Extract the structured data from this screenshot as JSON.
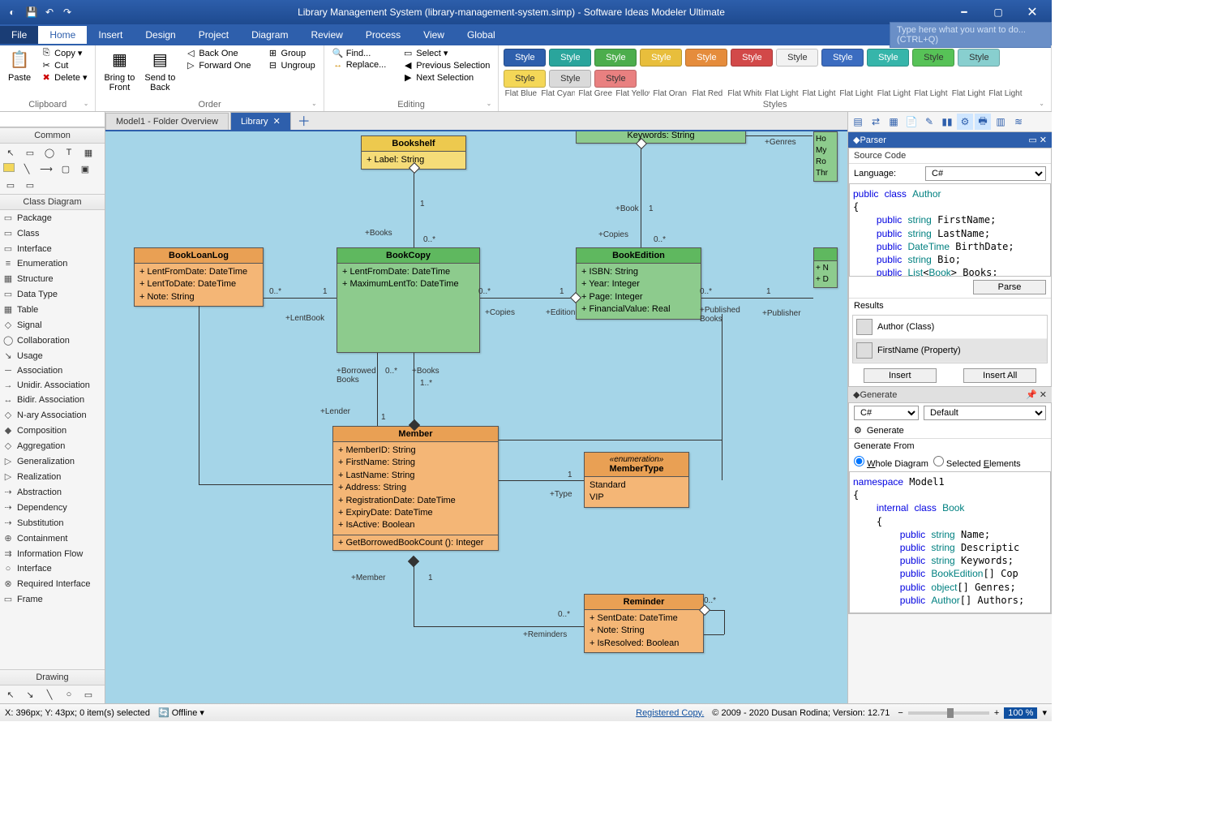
{
  "window_title": "Library Management System (library-management-system.simp) - Software Ideas Modeler Ultimate",
  "menu": {
    "file": "File",
    "home": "Home",
    "insert": "Insert",
    "design": "Design",
    "project": "Project",
    "diagram": "Diagram",
    "review": "Review",
    "process": "Process",
    "view": "View",
    "global": "Global",
    "search_placeholder": "Type here what you want to do... (CTRL+Q)"
  },
  "ribbon": {
    "clipboard": {
      "paste": "Paste",
      "copy": "Copy",
      "cut": "Cut",
      "delete": "Delete",
      "label": "Clipboard"
    },
    "order": {
      "bring": "Bring to\nFront",
      "send": "Send to\nBack",
      "back_one": "Back One",
      "forward_one": "Forward One",
      "group": "Group",
      "ungroup": "Ungroup",
      "label": "Order"
    },
    "editing": {
      "find": "Find...",
      "replace": "Replace...",
      "select": "Select",
      "prev": "Previous Selection",
      "next": "Next Selection",
      "label": "Editing"
    },
    "styles": {
      "label": "Styles",
      "names": [
        "Flat Blue",
        "Flat Cyan",
        "Flat Green",
        "Flat Yellow",
        "Flat Orang",
        "Flat Red",
        "Flat White",
        "Flat Light B",
        "Flat Light C",
        "Flat Light G",
        "Flat Light",
        "Flat Light Y",
        "Flat Light",
        "Flat Light R"
      ],
      "swatch_text": "Style",
      "colors": [
        "#2e5fac",
        "#2aa59c",
        "#4cad4c",
        "#e8be3c",
        "#e58c3c",
        "#d24949",
        "#f2f2f2",
        "#3b6cc0",
        "#36b5aa",
        "#57c257",
        "#88cfcf",
        "#f4d757",
        "#dadada",
        "#e98080"
      ]
    }
  },
  "left_panel": {
    "common": "Common",
    "class": "Class Diagram",
    "drawing": "Drawing",
    "tools": [
      "Package",
      "Class",
      "Interface",
      "Enumeration",
      "Structure",
      "Data Type",
      "Table",
      "Signal",
      "Collaboration",
      "Usage",
      "Association",
      "Unidir. Association",
      "Bidir. Association",
      "N-ary Association",
      "Composition",
      "Aggregation",
      "Generalization",
      "Realization",
      "Abstraction",
      "Dependency",
      "Substitution",
      "Containment",
      "Information Flow",
      "Interface",
      "Required Interface",
      "Frame"
    ]
  },
  "doc_tabs": {
    "t1": "Model1 - Folder Overview",
    "t2": "Library"
  },
  "diagram": {
    "bookshelf": {
      "name": "Bookshelf",
      "attrs": [
        "+ Label: String"
      ]
    },
    "bookloanlog": {
      "name": "BookLoanLog",
      "attrs": [
        "+ LentFromDate: DateTime",
        "+ LentToDate: DateTime",
        "+ Note: String"
      ]
    },
    "bookcopy": {
      "name": "BookCopy",
      "attrs": [
        "+ LentFromDate: DateTime",
        "+ MaximumLentTo: DateTime"
      ]
    },
    "bookedition": {
      "name": "BookEdition",
      "attrs": [
        "+ ISBN: String",
        "+ Year: Integer",
        "+ Page: Integer",
        "+ FinancialValue: Real"
      ]
    },
    "member": {
      "name": "Member",
      "attrs": [
        "+ MemberID: String",
        "+ FirstName: String",
        "+ LastName: String",
        "+ Address: String",
        "+ RegistrationDate: DateTime",
        "+ ExpiryDate: DateTime",
        "+ IsActive: Boolean"
      ],
      "ops": [
        "+ GetBorrowedBookCount (): Integer"
      ]
    },
    "membertype": {
      "stereo": "«enumeration»",
      "name": "MemberType",
      "attrs": [
        "Standard",
        "VIP"
      ]
    },
    "reminder": {
      "name": "Reminder",
      "attrs": [
        "+ SentDate: DateTime",
        "+ Note: String",
        "+ IsResolved: Boolean"
      ]
    },
    "roles": {
      "books": "+Books",
      "book": "+Book",
      "copies": "+Copies",
      "lentbook": "+LentBook",
      "edition": "+Edition",
      "publishedbooks": "+Published\nBooks",
      "publisher": "+Publisher",
      "borrowed": "+Borrowed\nBooks",
      "lender": "+Lender",
      "booksM": "+Books",
      "member": "+Member",
      "type": "+Type",
      "reminders": "+Reminders",
      "genres": "+Genres",
      "keywords": "Keywords: String"
    },
    "mult": {
      "zero_star": "0..*",
      "one": "1",
      "one_star": "1..*"
    },
    "side_frag": {
      "l1": "Ho",
      "l2": "My",
      "l3": "Ro",
      "l4": "Thr",
      "a1": "+ N",
      "a2": "+ D"
    }
  },
  "right": {
    "parser_hdr": "Parser",
    "source_code": "Source Code",
    "language": "Language:",
    "lang_val": "C#",
    "parse": "Parse",
    "results": "Results",
    "r1": "Author (Class)",
    "r2": "FirstName (Property)",
    "insert": "Insert",
    "insert_all": "Insert All",
    "generate_hdr": "Generate",
    "gen_lang": "C#",
    "gen_template": "Default",
    "generate": "Generate",
    "gen_from": "Generate From",
    "whole": "Whole Diagram",
    "sel": "Selected Elements",
    "code1_lines": [
      "public class Author",
      "{",
      "    public string FirstName;",
      "    public string LastName;",
      "    public DateTime BirthDate;",
      "    public string Bio;",
      "    public List<Book> Books;"
    ],
    "code2_lines": [
      "namespace Model1",
      "{",
      "    internal class Book",
      "    {",
      "        public string Name;",
      "        public string Descriptic",
      "        public string Keywords;",
      "        public BookEdition[] Cop",
      "        public object[] Genres;",
      "        public Author[] Authors;",
      "",
      "    }"
    ]
  },
  "status": {
    "coords": "X: 396px; Y: 43px; 0 item(s) selected",
    "offline": "Offline",
    "registered": "Registered Copy.",
    "copyright": "© 2009 - 2020 Dusan Rodina; Version: 12.71",
    "zoom": "100 %"
  }
}
